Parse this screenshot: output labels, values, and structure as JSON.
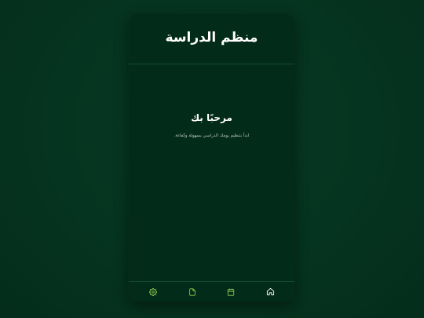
{
  "header": {
    "title": "منظم الدراسة"
  },
  "main": {
    "welcome_title": "مرحبًا بك",
    "welcome_subtitle": "ابدأ بتنظيم يومك الدراسي بسهولة وكفاءة."
  },
  "nav": {
    "items": [
      {
        "icon": "gear-icon",
        "active": false
      },
      {
        "icon": "file-icon",
        "active": false
      },
      {
        "icon": "calendar-icon",
        "active": false
      },
      {
        "icon": "home-icon",
        "active": true
      }
    ]
  },
  "colors": {
    "background": "#05331f",
    "card": "#032b19",
    "accent": "#8fd14f",
    "active_icon": "#ffffff",
    "divider": "#0f4a30"
  }
}
